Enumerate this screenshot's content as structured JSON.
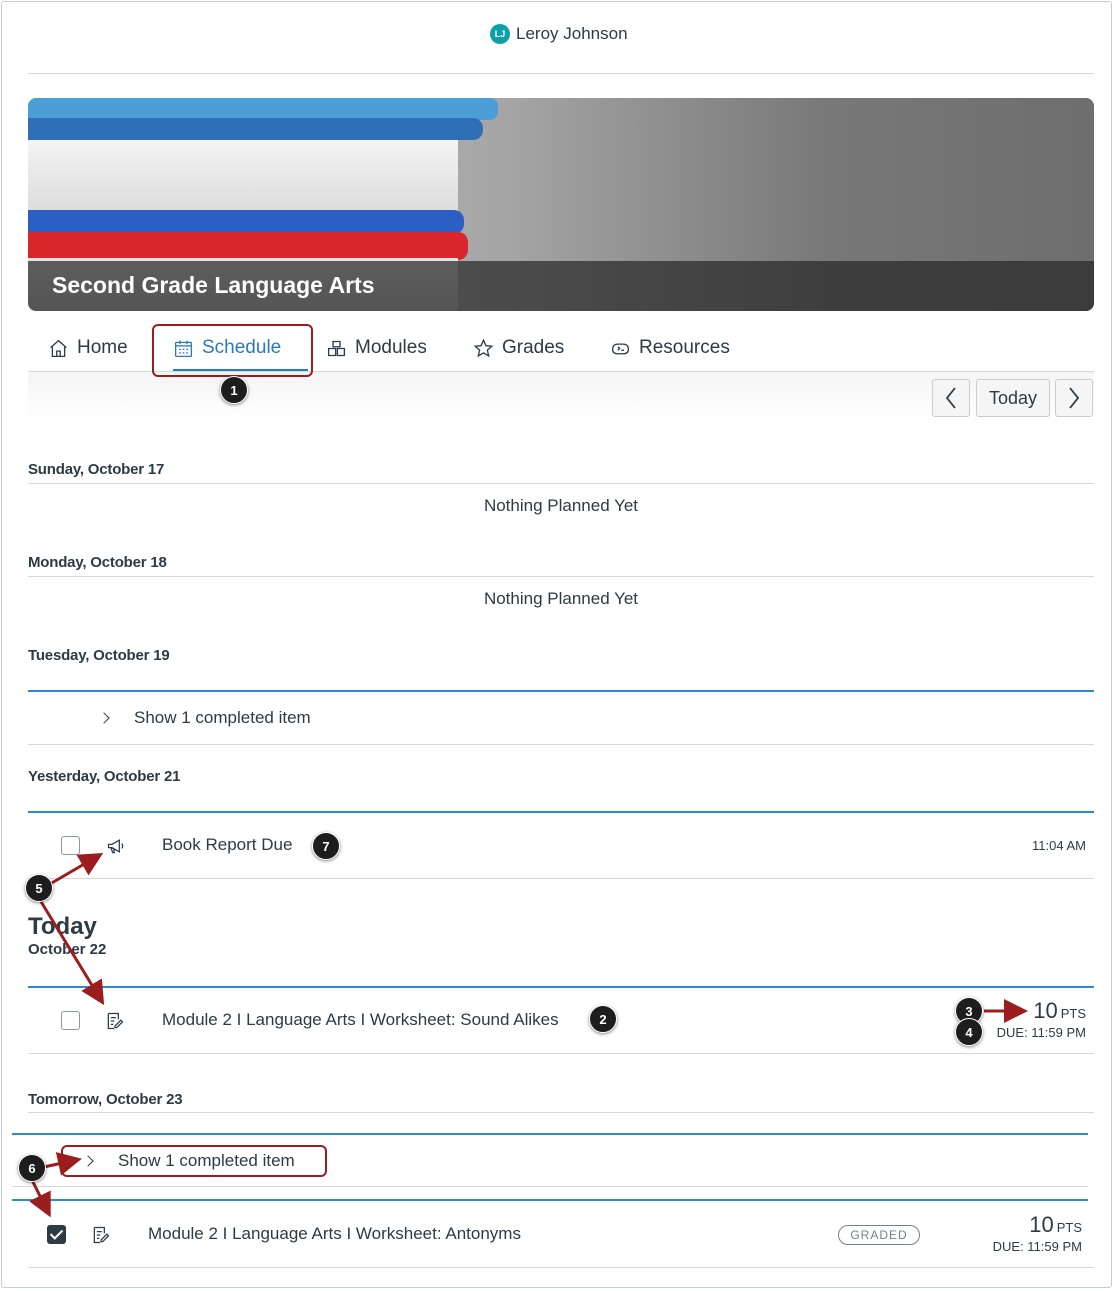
{
  "user": {
    "initials": "LJ",
    "name": "Leroy Johnson"
  },
  "course": {
    "title": "Second Grade Language Arts"
  },
  "tabs": [
    {
      "label": "Home",
      "icon": "home-icon"
    },
    {
      "label": "Schedule",
      "icon": "calendar-icon",
      "active": true
    },
    {
      "label": "Modules",
      "icon": "modules-icon"
    },
    {
      "label": "Grades",
      "icon": "star-icon"
    },
    {
      "label": "Resources",
      "icon": "resources-icon"
    }
  ],
  "nav": {
    "prev_icon": "chevron-left-icon",
    "today_label": "Today",
    "next_icon": "chevron-right-icon"
  },
  "days": {
    "sun": {
      "heading": "Sunday, October 17",
      "empty": "Nothing Planned Yet"
    },
    "mon": {
      "heading": "Monday, October 18",
      "empty": "Nothing Planned Yet"
    },
    "tue": {
      "heading": "Tuesday, October 19",
      "show_completed": "Show 1 completed item"
    },
    "yesterday": {
      "heading": "Yesterday, October 21",
      "item": {
        "title": "Book Report Due",
        "icon": "announcement-icon",
        "time": "11:04 AM"
      }
    },
    "today": {
      "big": "Today",
      "sub": "October 22",
      "item": {
        "title": "Module 2 I Language Arts I Worksheet: Sound Alikes",
        "icon": "assignment-icon",
        "points": "10",
        "points_unit": "PTS",
        "due": "DUE: 11:59 PM"
      }
    },
    "tomorrow": {
      "heading": "Tomorrow, October 23",
      "show_completed": "Show 1 completed item",
      "item": {
        "title": "Module 2 I Language Arts I Worksheet: Antonyms",
        "icon": "assignment-icon",
        "status": "GRADED",
        "points": "10",
        "points_unit": "PTS",
        "due": "DUE: 11:59 PM",
        "checked": true
      }
    }
  },
  "callouts": [
    "1",
    "2",
    "3",
    "4",
    "5",
    "6",
    "7"
  ],
  "colors": {
    "accent": "#2b7abc",
    "annotation": "#9b1d1d",
    "avatar": "#0e9fa8"
  }
}
